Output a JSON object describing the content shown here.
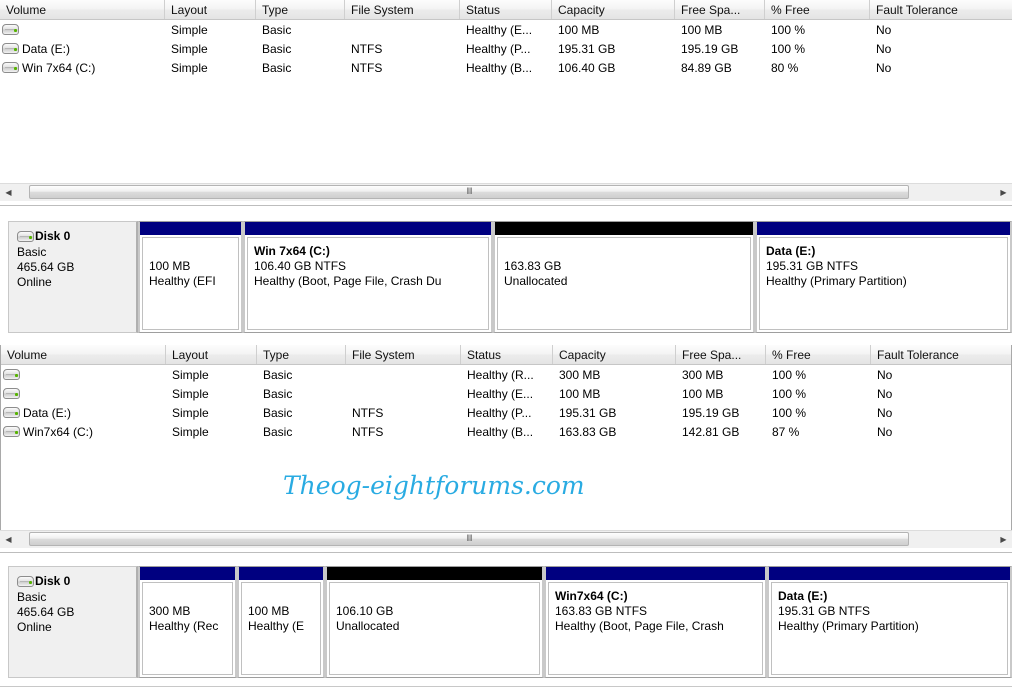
{
  "volume_list_columns": [
    "Volume",
    "Layout",
    "Type",
    "File System",
    "Status",
    "Capacity",
    "Free Spa...",
    "% Free",
    "Fault Tolerance"
  ],
  "top_panel": {
    "rows": [
      {
        "volume": "",
        "layout": "Simple",
        "type": "Basic",
        "file_system": "",
        "status": "Healthy (E...",
        "capacity": "100 MB",
        "free_space": "100 MB",
        "percent_free": "100 %",
        "fault_tolerance": "No"
      },
      {
        "volume": "Data (E:)",
        "layout": "Simple",
        "type": "Basic",
        "file_system": "NTFS",
        "status": "Healthy (P...",
        "capacity": "195.31 GB",
        "free_space": "195.19 GB",
        "percent_free": "100 %",
        "fault_tolerance": "No"
      },
      {
        "volume": "Win 7x64 (C:)",
        "layout": "Simple",
        "type": "Basic",
        "file_system": "NTFS",
        "status": "Healthy (B...",
        "capacity": "106.40 GB",
        "free_space": "84.89 GB",
        "percent_free": "80 %",
        "fault_tolerance": "No"
      }
    ],
    "disk": {
      "name": "Disk 0",
      "type": "Basic",
      "size": "465.64 GB",
      "state": "Online",
      "partitions": [
        {
          "name": "",
          "size": "100 MB",
          "status": "Healthy (EFI",
          "kind": "allocated"
        },
        {
          "name": "Win 7x64  (C:)",
          "size": "106.40 GB NTFS",
          "status": "Healthy (Boot, Page File, Crash Du",
          "kind": "allocated"
        },
        {
          "name": "",
          "size": "163.83 GB",
          "status": "Unallocated",
          "kind": "unallocated"
        },
        {
          "name": "Data  (E:)",
          "size": "195.31 GB NTFS",
          "status": "Healthy (Primary Partition)",
          "kind": "allocated"
        }
      ]
    }
  },
  "bottom_panel": {
    "rows": [
      {
        "volume": "",
        "layout": "Simple",
        "type": "Basic",
        "file_system": "",
        "status": "Healthy (R...",
        "capacity": "300 MB",
        "free_space": "300 MB",
        "percent_free": "100 %",
        "fault_tolerance": "No"
      },
      {
        "volume": "",
        "layout": "Simple",
        "type": "Basic",
        "file_system": "",
        "status": "Healthy (E...",
        "capacity": "100 MB",
        "free_space": "100 MB",
        "percent_free": "100 %",
        "fault_tolerance": "No"
      },
      {
        "volume": "Data (E:)",
        "layout": "Simple",
        "type": "Basic",
        "file_system": "NTFS",
        "status": "Healthy (P...",
        "capacity": "195.31 GB",
        "free_space": "195.19 GB",
        "percent_free": "100 %",
        "fault_tolerance": "No"
      },
      {
        "volume": "Win7x64 (C:)",
        "layout": "Simple",
        "type": "Basic",
        "file_system": "NTFS",
        "status": "Healthy (B...",
        "capacity": "163.83 GB",
        "free_space": "142.81 GB",
        "percent_free": "87 %",
        "fault_tolerance": "No"
      }
    ],
    "disk": {
      "name": "Disk 0",
      "type": "Basic",
      "size": "465.64 GB",
      "state": "Online",
      "partitions": [
        {
          "name": "",
          "size": "300 MB",
          "status": "Healthy (Rec",
          "kind": "allocated"
        },
        {
          "name": "",
          "size": "100 MB",
          "status": "Healthy (E",
          "kind": "allocated"
        },
        {
          "name": "",
          "size": "106.10 GB",
          "status": "Unallocated",
          "kind": "unallocated"
        },
        {
          "name": "Win7x64  (C:)",
          "size": "163.83 GB NTFS",
          "status": "Healthy (Boot, Page File, Crash",
          "kind": "allocated"
        },
        {
          "name": "Data  (E:)",
          "size": "195.31 GB NTFS",
          "status": "Healthy (Primary Partition)",
          "kind": "allocated"
        }
      ]
    }
  },
  "watermark": {
    "text": "Theog-eightforums.com",
    "color": "#29ABE2"
  },
  "scrollbar": {
    "left_arrow": "◀",
    "right_arrow": "▶",
    "grip": "‖‖"
  },
  "colors": {
    "partition_header": "#000080",
    "unallocated_header": "#000000"
  }
}
